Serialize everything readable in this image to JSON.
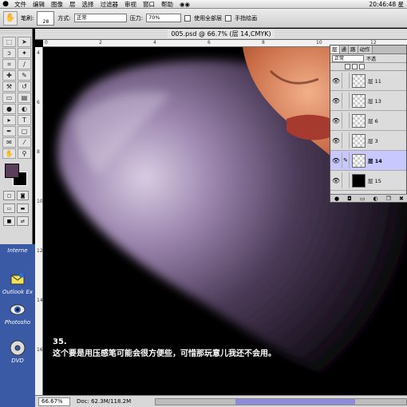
{
  "menubar": {
    "items": [
      "文件",
      "编辑",
      "图像",
      "层",
      "选择",
      "过滤器",
      "审视",
      "窗口",
      "帮助"
    ],
    "clock": "20:46:48 星"
  },
  "options": {
    "brush_label": "笔刷:",
    "brush_size": "28",
    "mode_label": "方式:",
    "mode_value": "正常",
    "opacity_label": "压力:",
    "opacity_value": "70%",
    "use_all_layers": "使用全部层",
    "finger_paint": "手指绘画"
  },
  "document": {
    "title": "005.psd @ 66.7% (层 14,CMYK)",
    "caption_line1": "35.",
    "caption_line2": "这个要是用压感笔可能会很方便些，可惜那玩意儿我还不会用。",
    "zoom": "66.67%",
    "doc_size": "Doc: 62.3M/118.2M",
    "ruler_top": [
      "0",
      "2",
      "4",
      "6",
      "8",
      "10",
      "12"
    ],
    "ruler_left": [
      "4",
      "6",
      "8",
      "10",
      "12",
      "14",
      "16"
    ]
  },
  "layers": {
    "tabs": [
      "层",
      "通",
      "路",
      "动作"
    ],
    "blend": "正常",
    "opacity_cut": "不透",
    "rows": [
      {
        "name": "层 11",
        "active": false
      },
      {
        "name": "层 13",
        "active": false
      },
      {
        "name": "层 6",
        "active": false
      },
      {
        "name": "层 3",
        "active": false
      },
      {
        "name": "层 14",
        "active": true
      },
      {
        "name": "层 15",
        "active": false
      }
    ]
  },
  "desktop": {
    "items": [
      "Interne",
      "Outlook Ex",
      "Photosho",
      "DVD"
    ]
  },
  "colors": {
    "foreground": "#5a3e5c",
    "background": "#000000",
    "desktop": "#3b5aa6"
  }
}
